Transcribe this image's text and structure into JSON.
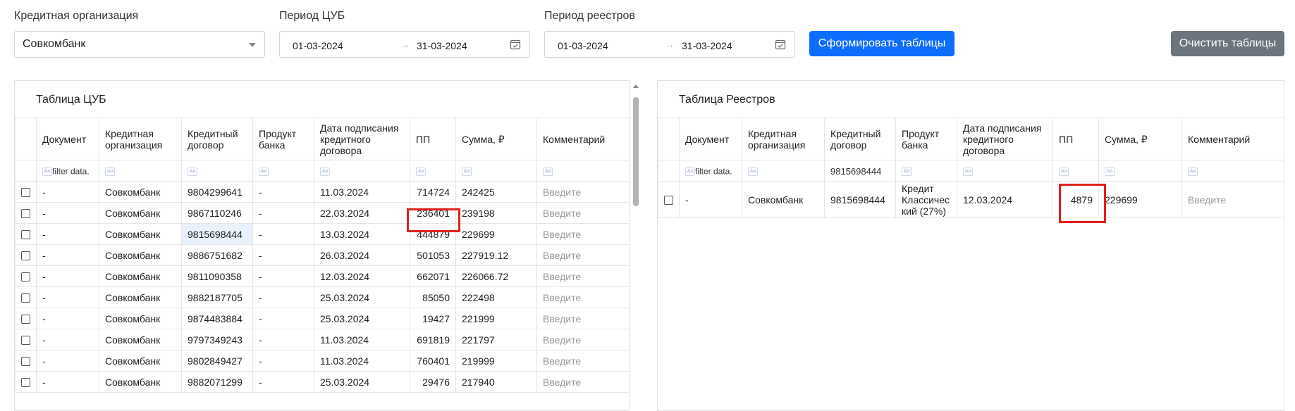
{
  "filters": {
    "org_label": "Кредитная организация",
    "org_value": "Совкомбанк",
    "cub_period_label": "Период ЦУБ",
    "cub_from": "01-03-2024",
    "cub_to": "31-03-2024",
    "reg_period_label": "Период реестров",
    "reg_from": "01-03-2024",
    "reg_to": "31-03-2024",
    "arrow": "→"
  },
  "buttons": {
    "generate": "Сформировать таблицы",
    "clear": "Очистить таблицы"
  },
  "colors": {
    "primary": "#0d6efd",
    "secondary": "#6c757d",
    "highlight": "#e02020"
  },
  "cub_table": {
    "title": "Таблица ЦУБ",
    "headers": [
      "Документ",
      "Кредитная организация",
      "Кредитный договор",
      "Продукт банка",
      "Дата подписания кредитного договора",
      "ПП",
      "Сумма, ₽",
      "Комментарий"
    ],
    "filter_placeholder": "filter data.",
    "rows": [
      {
        "doc": "-",
        "org": "Совкомбанк",
        "contract": "9804299641",
        "product": "-",
        "date": "11.03.2024",
        "pp": "714724",
        "sum": "242425",
        "comment": "Введите"
      },
      {
        "doc": "-",
        "org": "Совкомбанк",
        "contract": "9867110246",
        "product": "-",
        "date": "22.03.2024",
        "pp": "236401",
        "sum": "239198",
        "comment": "Введите"
      },
      {
        "doc": "-",
        "org": "Совкомбанк",
        "contract": "9815698444",
        "product": "-",
        "date": "13.03.2024",
        "pp": "444879",
        "sum": "229699",
        "comment": "Введите"
      },
      {
        "doc": "-",
        "org": "Совкомбанк",
        "contract": "9886751682",
        "product": "-",
        "date": "26.03.2024",
        "pp": "501053",
        "sum": "227919.12",
        "comment": "Введите"
      },
      {
        "doc": "-",
        "org": "Совкомбанк",
        "contract": "9811090358",
        "product": "-",
        "date": "12.03.2024",
        "pp": "662071",
        "sum": "226066.72",
        "comment": "Введите"
      },
      {
        "doc": "-",
        "org": "Совкомбанк",
        "contract": "9882187705",
        "product": "-",
        "date": "25.03.2024",
        "pp": "85050",
        "sum": "222498",
        "comment": "Введите"
      },
      {
        "doc": "-",
        "org": "Совкомбанк",
        "contract": "9874483884",
        "product": "-",
        "date": "25.03.2024",
        "pp": "19427",
        "sum": "221999",
        "comment": "Введите"
      },
      {
        "doc": "-",
        "org": "Совкомбанк",
        "contract": "9797349243",
        "product": "-",
        "date": "11.03.2024",
        "pp": "691819",
        "sum": "221797",
        "comment": "Введите"
      },
      {
        "doc": "-",
        "org": "Совкомбанк",
        "contract": "9802849427",
        "product": "-",
        "date": "11.03.2024",
        "pp": "760401",
        "sum": "219999",
        "comment": "Введите"
      },
      {
        "doc": "-",
        "org": "Совкомбанк",
        "contract": "9882071299",
        "product": "-",
        "date": "25.03.2024",
        "pp": "29476",
        "sum": "217940",
        "comment": "Введите"
      }
    ]
  },
  "reg_table": {
    "title": "Таблица Реестров",
    "headers": [
      "Документ",
      "Кредитная организация",
      "Кредитный договор",
      "Продукт банка",
      "Дата подписания кредитного договора",
      "ПП",
      "Сумма, ₽",
      "Комментарий"
    ],
    "filter_placeholder": "filter data.",
    "contract_filter": "9815698444",
    "rows": [
      {
        "doc": "-",
        "org": "Совкомбанк",
        "contract": "9815698444",
        "product": "Кредит Классичес кий (27%)",
        "date": "12.03.2024",
        "pp": "4879",
        "sum": "229699",
        "comment": "Введите"
      }
    ]
  }
}
